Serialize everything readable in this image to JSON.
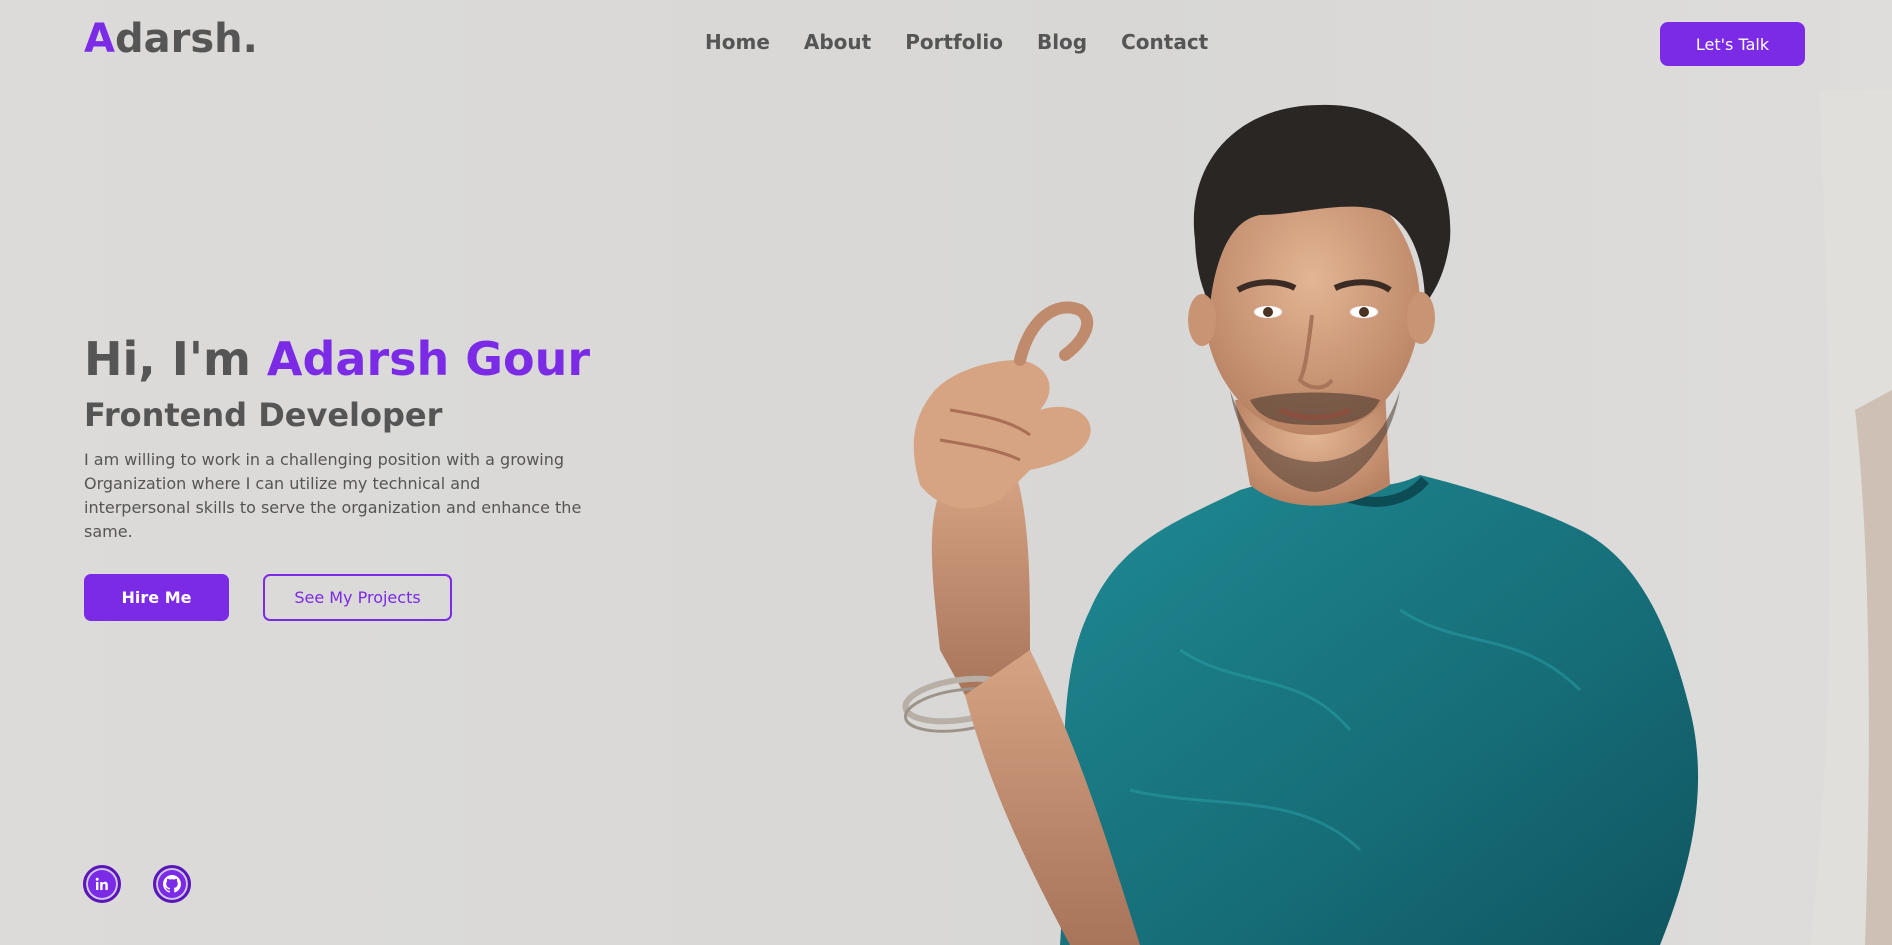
{
  "header": {
    "logo_first": "A",
    "logo_rest": "darsh.",
    "nav": [
      "Home",
      "About",
      "Portfolio",
      "Blog",
      "Contact"
    ],
    "cta": "Let's Talk"
  },
  "hero": {
    "greeting": "Hi, I'm ",
    "name": "Adarsh Gour",
    "role": "Frontend Developer",
    "description": "I am willing to work in a challenging position with a growing Organization where I can utilize my technical and interpersonal skills to serve the organization and enhance the same.",
    "hire_btn": "Hire Me",
    "projects_btn": "See My Projects"
  },
  "social": [
    "linkedin-icon",
    "github-icon"
  ],
  "colors": {
    "accent": "#7b2ae6",
    "text": "#555555",
    "background": "#d9d8d6"
  }
}
